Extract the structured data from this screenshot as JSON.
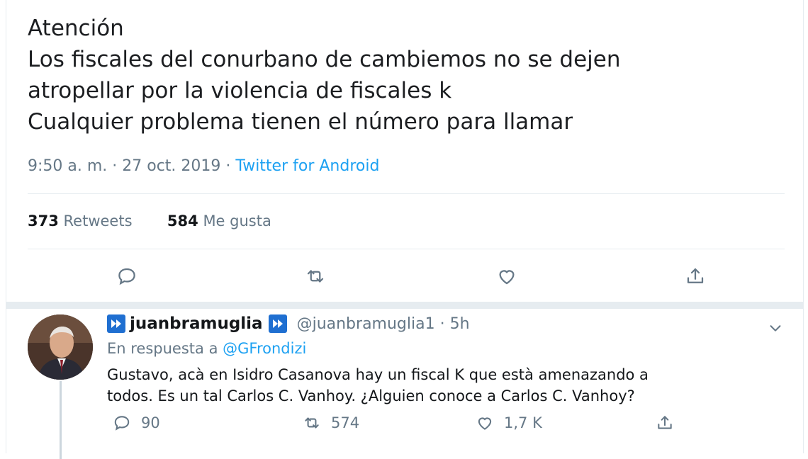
{
  "tweet": {
    "lines": [
      "Atención",
      "Los fiscales del conurbano de cambiemos no se dejen",
      "atropellar por la violencia de fiscales k",
      "Cualquier problema tienen el número para llamar"
    ],
    "time": "9:50 a. m. · 27 oct. 2019 ·",
    "source": "Twitter for Android",
    "retweets_count": "373",
    "retweets_label": "Retweets",
    "likes_count": "584",
    "likes_label": "Me gusta",
    "action_icons": [
      "reply-icon",
      "retweet-icon",
      "like-icon",
      "share-icon"
    ]
  },
  "reply": {
    "name": "juanbramuglia",
    "handle": "@juanbramuglia1 · 5h",
    "replying_prefix": "En respuesta a",
    "replying_to": "@GFrondizi",
    "text_lines": [
      "Gustavo, acà en Isidro Casanova hay un fiscal K que està amenazando a",
      "todos. Es un tal Carlos C. Vanhoy. ¿Alguien conoce a Carlos C. Vanhoy?"
    ],
    "replies": "90",
    "retweets": "574",
    "likes": "1,7 K"
  },
  "colors": {
    "accent": "#1da1f2",
    "muted": "#657786",
    "badge": "#1f6fd1"
  }
}
